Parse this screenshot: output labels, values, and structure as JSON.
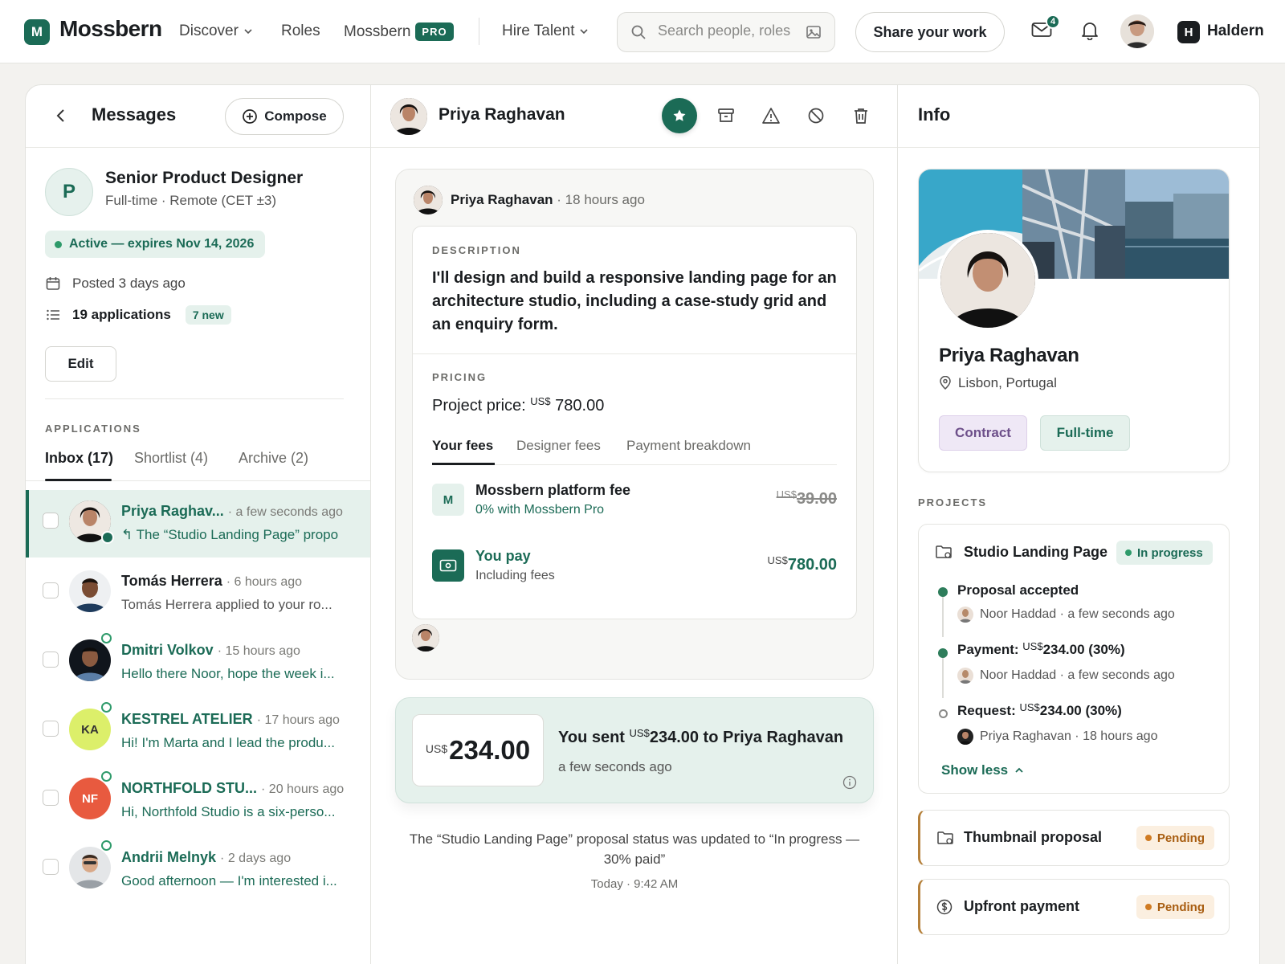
{
  "app": {
    "logo_letter": "M",
    "name": "Mossbern",
    "brand_color": "#1b6b56"
  },
  "nav": {
    "discover": "Discover",
    "roles": "Roles",
    "pro_label": "Mossbern",
    "pro_badge": "PRO",
    "hire": "Hire Talent",
    "search_placeholder": "Search people, roles",
    "share": "Share your work",
    "mail_count": "4",
    "user_initial": "H",
    "user_name": "Haldern"
  },
  "messages": {
    "title": "Messages",
    "compose": "Compose",
    "job": {
      "initial": "P",
      "title": "Senior Product Designer",
      "subtitle": "Full-time · Remote (CET ±3)",
      "status": "Active — expires Nov 14, 2026",
      "posted": "Posted 3 days ago",
      "applications": "19 applications",
      "new_count": "7 new",
      "edit": "Edit"
    },
    "applications_label": "APPLICATIONS",
    "tabs": [
      "Inbox (17)",
      "Shortlist (4)",
      "Archive (2)"
    ],
    "items": [
      {
        "name": "Priya Raghav...",
        "time": "· a few seconds ago",
        "preview": "The “Studio Landing Page” propo",
        "selected": true
      },
      {
        "name": "Tomás Herrera",
        "time": "· 6 hours ago",
        "preview": "Tomás Herrera applied to your ro..."
      },
      {
        "name": "Dmitri Volkov",
        "time": "· 15 hours ago",
        "preview": "Hello there Noor, hope the week i..."
      },
      {
        "name": "KESTREL ATELIER",
        "time": "· 17 hours ago",
        "preview": "Hi! I'm Marta and I lead the produ...",
        "initials": "KA"
      },
      {
        "name": "NORTHFOLD STU...",
        "time": "· 20 hours ago",
        "preview": "Hi, Northfold Studio is a six-perso...",
        "initials": "NF"
      },
      {
        "name": "Andrii Melnyk",
        "time": "· 2 days ago",
        "preview": "Good afternoon — I'm interested i..."
      }
    ]
  },
  "chat": {
    "name": "Priya Raghavan",
    "proposal": {
      "sender": "Priya Raghavan",
      "time": "· 18 hours ago",
      "description_label": "DESCRIPTION",
      "description": "I'll design and build a responsive landing page for an architecture studio, including a case-study grid and an enquiry form.",
      "pricing_label": "PRICING",
      "price_label": "Project price:",
      "currency": "US$",
      "price": "780.00",
      "fee_tabs": [
        "Your fees",
        "Designer fees",
        "Payment breakdown"
      ],
      "platform_fee_icon": "M",
      "platform_fee_title": "Mossbern platform fee",
      "platform_fee_sub": "0% with Mossbern Pro",
      "platform_fee_amount": "39.00",
      "you_pay_title": "You pay",
      "you_pay_sub": "Including fees",
      "you_pay_amount": "780.00"
    },
    "payment": {
      "currency": "US$",
      "amount": "234.00",
      "title_prefix": "You sent",
      "title_suffix": "234.00 to Priya Raghavan",
      "time": "a few seconds ago"
    },
    "status_note": "The “Studio Landing Page” proposal status was updated to “In progress — 30% paid”",
    "status_time": "Today · 9:42 AM"
  },
  "info": {
    "title": "Info",
    "name": "Priya Raghavan",
    "location": "Lisbon, Portugal",
    "tags": [
      "Contract",
      "Full-time"
    ],
    "projects_label": "PROJECTS",
    "project": {
      "title": "Studio Landing Page",
      "status": "In progress",
      "timeline": [
        {
          "title": "Proposal accepted",
          "who": "Noor Haddad · a few seconds ago"
        },
        {
          "title": "Payment:",
          "cur": "US$",
          "amount": "234.00 (30%)",
          "who": "Noor Haddad · a few seconds ago"
        },
        {
          "title": "Request:",
          "cur": "US$",
          "amount": "234.00 (30%)",
          "who": "Priya Raghavan · 18 hours ago"
        }
      ],
      "show_less": "Show less"
    },
    "pending": [
      {
        "title": "Thumbnail proposal",
        "status": "Pending"
      },
      {
        "title": "Upfront payment",
        "status": "Pending"
      }
    ]
  }
}
